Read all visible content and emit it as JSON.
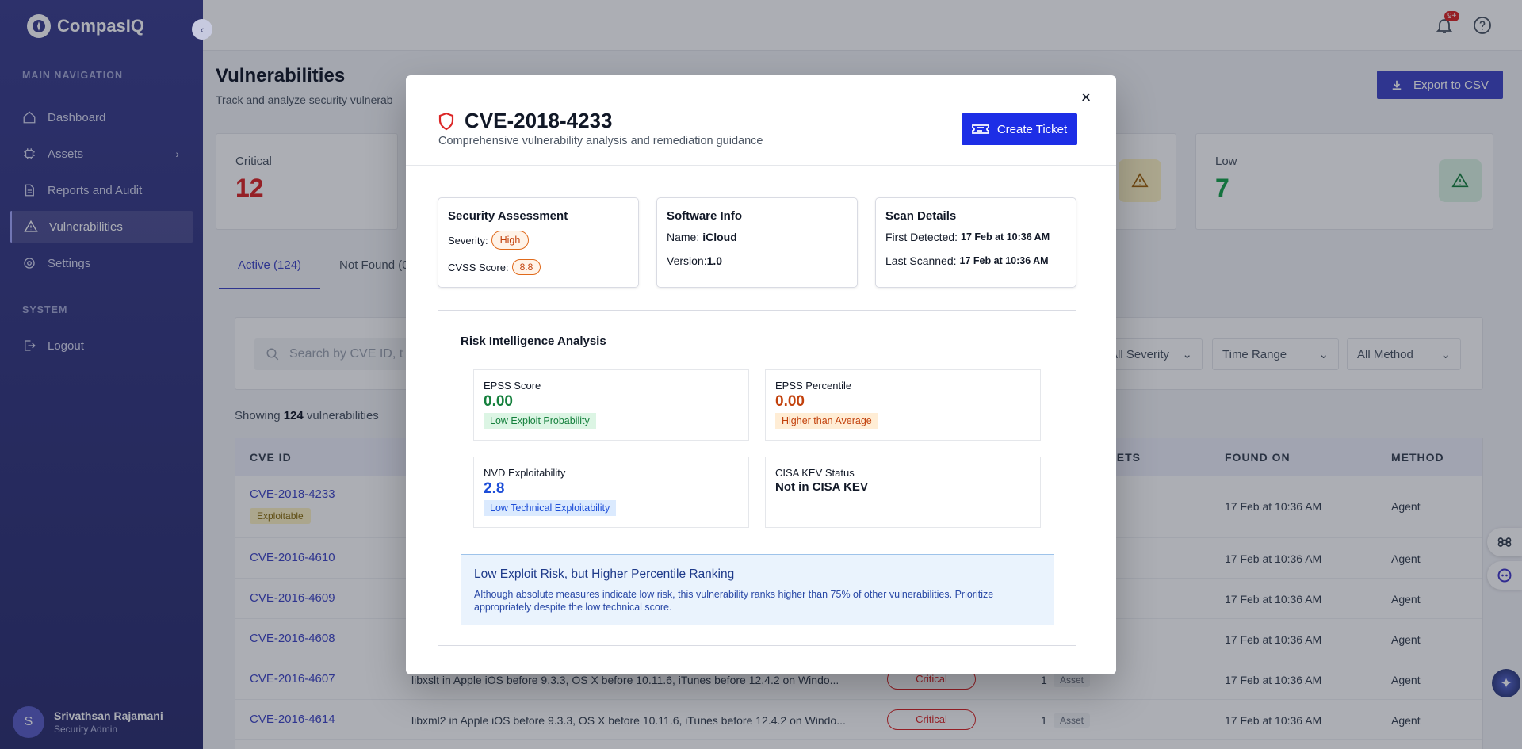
{
  "app": {
    "name": "CompasIQ"
  },
  "sidebar": {
    "main_label": "MAIN NAVIGATION",
    "system_label": "SYSTEM",
    "items": [
      {
        "label": "Dashboard"
      },
      {
        "label": "Assets"
      },
      {
        "label": "Reports and Audit"
      },
      {
        "label": "Vulnerabilities"
      },
      {
        "label": "Settings"
      }
    ],
    "logout": "Logout",
    "user": {
      "initial": "S",
      "name": "Srivathsan Rajamani",
      "role": "Security Admin"
    }
  },
  "topbar": {
    "notification_count": "9+"
  },
  "page": {
    "title": "Vulnerabilities",
    "subtitle": "Track and analyze security vulnerab",
    "export_label": "Export to CSV"
  },
  "stats": {
    "critical": {
      "label": "Critical",
      "value": "12",
      "color": "#dc2626"
    },
    "low": {
      "label": "Low",
      "value": "7",
      "color": "#16a34a"
    }
  },
  "tabs": {
    "active": "Active (124)",
    "not_found": "Not Found (0"
  },
  "filters": {
    "search_placeholder": "Search by CVE ID, t",
    "severity": "All Severity",
    "time_range": "Time Range",
    "method": "All Method"
  },
  "showing": {
    "prefix": "Showing",
    "count": "124",
    "suffix": "vulnerabilities"
  },
  "table": {
    "headers": {
      "cve_id": "CVE ID",
      "assets": "ASSETS",
      "found_on": "FOUND ON",
      "method": "METHOD"
    },
    "rows": [
      {
        "cve": "CVE-2018-4233",
        "tag": "Exploitable",
        "desc": "",
        "severity": "",
        "assets": "",
        "asset_label": "",
        "found": "17 Feb at 10:36 AM",
        "method": "Agent"
      },
      {
        "cve": "CVE-2016-4610",
        "found": "17 Feb at 10:36 AM",
        "method": "Agent"
      },
      {
        "cve": "CVE-2016-4609",
        "found": "17 Feb at 10:36 AM",
        "method": "Agent"
      },
      {
        "cve": "CVE-2016-4608",
        "found": "17 Feb at 10:36 AM",
        "method": "Agent"
      },
      {
        "cve": "CVE-2016-4607",
        "desc": "libxslt in Apple iOS before 9.3.3, OS X before 10.11.6, iTunes before 12.4.2 on Windo...",
        "severity": "Critical",
        "assets": "1",
        "asset_label": "Asset",
        "found": "17 Feb at 10:36 AM",
        "method": "Agent"
      },
      {
        "cve": "CVE-2016-4614",
        "desc": "libxml2 in Apple iOS before 9.3.3, OS X before 10.11.6, iTunes before 12.4.2 on Windo...",
        "severity": "Critical",
        "assets": "1",
        "asset_label": "Asset",
        "found": "17 Feb at 10:36 AM",
        "method": "Agent"
      }
    ]
  },
  "modal": {
    "title": "CVE-2018-4233",
    "subtitle": "Comprehensive vulnerability analysis and remediation guidance",
    "create_ticket": "Create Ticket",
    "close": "×",
    "security": {
      "heading": "Security Assessment",
      "severity_label": "Severity:",
      "severity_value": "High",
      "cvss_label": "CVSS Score:",
      "cvss_value": "8.8"
    },
    "software": {
      "heading": "Software Info",
      "name_label": "Name:",
      "name_value": "iCloud",
      "version_label": "Version:",
      "version_value": "1.0"
    },
    "scan": {
      "heading": "Scan Details",
      "first_label": "First Detected:",
      "first_value": "17 Feb at 10:36 AM",
      "last_label": "Last Scanned:",
      "last_value": "17 Feb at 10:36 AM"
    },
    "risk": {
      "title": "Risk Intelligence Analysis",
      "epss_score": {
        "label": "EPSS Score",
        "value": "0.00",
        "tag": "Low Exploit Probability"
      },
      "epss_percentile": {
        "label": "EPSS Percentile",
        "value": "0.00",
        "tag": "Higher than Average"
      },
      "nvd": {
        "label": "NVD Exploitability",
        "value": "2.8",
        "tag": "Low Technical Exploitability"
      },
      "cisa": {
        "label": "CISA KEV Status",
        "value": "Not in CISA KEV"
      },
      "advice_title": "Low Exploit Risk, but Higher Percentile Ranking",
      "advice_text": "Although absolute measures indicate low risk, this vulnerability ranks higher than 75% of other vulnerabilities. Prioritize appropriately despite the low technical score."
    }
  }
}
